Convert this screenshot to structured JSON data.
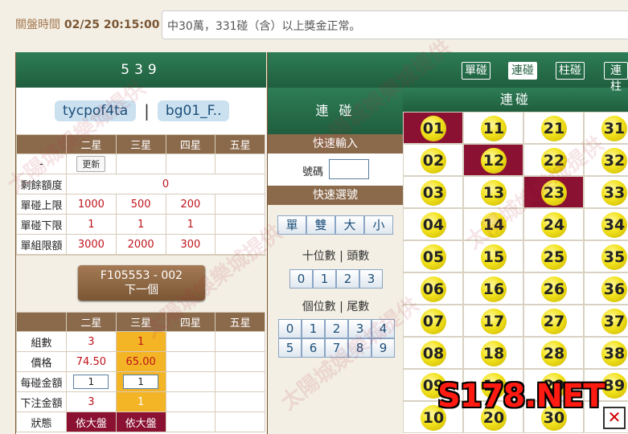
{
  "header": {
    "close_label": "關盤時間",
    "close_time": "02/25 20:15:00",
    "marquee": "中30萬，331碰（含）以上獎金正常。"
  },
  "left": {
    "game_title": "539",
    "users": [
      "tycpof4ta",
      "bg01_F.."
    ],
    "user_sep": "|",
    "cols": [
      "二星",
      "三星",
      "四星",
      "五星"
    ],
    "rows": [
      {
        "label": "-",
        "update": "更新"
      },
      {
        "label": "剩餘額度",
        "value": "0"
      },
      {
        "label": "單碰上限",
        "values": [
          "1000",
          "500",
          "200",
          ""
        ]
      },
      {
        "label": "單碰下限",
        "values": [
          "1",
          "1",
          "1",
          ""
        ]
      },
      {
        "label": "單組限額",
        "values": [
          "3000",
          "2000",
          "300",
          ""
        ]
      }
    ],
    "next_btn_line1": "F105553 - 002",
    "next_btn_line2": "下一個",
    "bet_cols": [
      "二星",
      "三星",
      "四星",
      "五星"
    ],
    "bet_rows": {
      "count_label": "組數",
      "count": [
        "3",
        "1"
      ],
      "price_label": "價格",
      "price": [
        "74.50",
        "65.00"
      ],
      "amount_label": "每碰金額",
      "amount": [
        "1",
        "1"
      ],
      "total_label": "下注金額",
      "total": [
        "3",
        "1"
      ],
      "status_label": "狀態",
      "status": [
        "依大盤",
        "依大盤"
      ]
    }
  },
  "mid": {
    "title": "連 碰",
    "quick_input": "快速輸入",
    "code_label": "號碼",
    "quick_select": "快速選號",
    "quick_btns": [
      "單",
      "雙",
      "大",
      "小"
    ],
    "tens_label": "十位數",
    "head_label": "頭數",
    "tens": [
      "0",
      "1",
      "2",
      "3"
    ],
    "units_label": "個位數",
    "tail_label": "尾數",
    "units_row1": [
      "0",
      "1",
      "2",
      "3",
      "4"
    ],
    "units_row2": [
      "5",
      "6",
      "7",
      "8",
      "9"
    ]
  },
  "right": {
    "tabs": [
      "單碰",
      "連碰",
      "柱碰",
      "連柱"
    ],
    "active_tab": "連碰",
    "subtitle": "連碰",
    "numbers": [
      [
        "01",
        "11",
        "21",
        "31"
      ],
      [
        "02",
        "12",
        "22",
        "32"
      ],
      [
        "03",
        "13",
        "23",
        "33"
      ],
      [
        "04",
        "14",
        "24",
        "34"
      ],
      [
        "05",
        "15",
        "25",
        "35"
      ],
      [
        "06",
        "16",
        "26",
        "36"
      ],
      [
        "07",
        "17",
        "27",
        "37"
      ],
      [
        "08",
        "18",
        "28",
        "38"
      ],
      [
        "09",
        "19",
        "29",
        "39"
      ],
      [
        "10",
        "20",
        "30",
        ""
      ]
    ],
    "selected": [
      "01",
      "12",
      "23"
    ]
  },
  "logo": "S178.NET",
  "watermark": "太陽城娛樂城提供",
  "colors": {
    "header_green": "#1f5e3e",
    "brown": "#8b6a4c",
    "selected": "#8a1132",
    "orange": "#f3b425"
  }
}
